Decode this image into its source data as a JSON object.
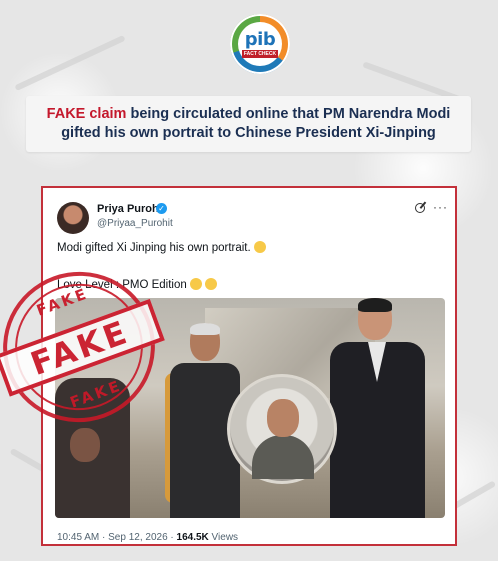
{
  "logo": {
    "text": "pib",
    "sub": "FACT CHECK"
  },
  "headline": {
    "fake_word": "FAKE claim",
    "line1_rest": " being circulated online that PM Narendra Modi",
    "line2": "gifted his own portrait to Chinese President Xi-Jinping"
  },
  "tweet": {
    "author_name": "Priya Purohit",
    "author_handle": "@Priyaa_Purohit",
    "text_line1": "Modi gifted Xi Jinping his own portrait.",
    "text_line2": "Love Level : PMO Edition",
    "timestamp": "10:45 AM · Sep 12, 2026 · ",
    "views_count": "164.5K",
    "views_label": " Views",
    "icons": [
      "verified-badge-icon",
      "grok-icon",
      "more-options-icon"
    ]
  },
  "stamp": {
    "top": "FAKE",
    "center": "FAKE",
    "bottom": "FAKE",
    "color": "#c81828"
  },
  "colors": {
    "fake_red": "#c4182c",
    "headline_navy": "#1b2f52",
    "card_border": "#c3303a"
  }
}
